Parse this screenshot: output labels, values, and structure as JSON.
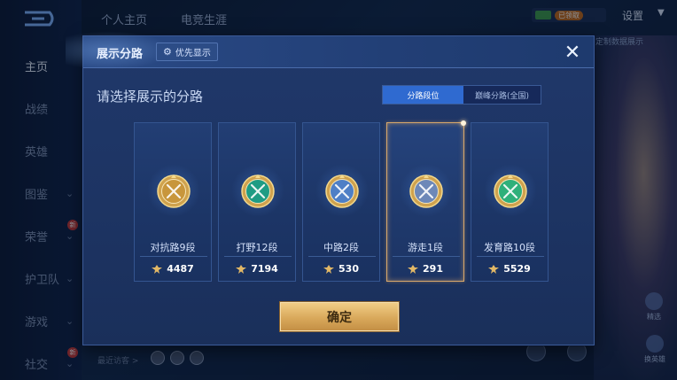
{
  "background": {
    "sidebar": {
      "items": [
        {
          "label": "主页",
          "active": true,
          "chevron": false,
          "new": false
        },
        {
          "label": "战绩",
          "active": false,
          "chevron": false,
          "new": false
        },
        {
          "label": "英雄",
          "active": false,
          "chevron": false,
          "new": false
        },
        {
          "label": "图鉴",
          "active": false,
          "chevron": true,
          "new": false
        },
        {
          "label": "荣誉",
          "active": false,
          "chevron": true,
          "new": true
        },
        {
          "label": "护卫队",
          "active": false,
          "chevron": true,
          "new": false
        },
        {
          "label": "游戏",
          "active": false,
          "chevron": true,
          "new": false
        },
        {
          "label": "社交",
          "active": false,
          "chevron": true,
          "new": true
        }
      ],
      "chevron": "⌄",
      "new_badge": "新"
    },
    "top_tabs": [
      "个人主页",
      "电竞生涯"
    ],
    "currency_badge": "已领取",
    "settings_label": "设置",
    "settings_caret": "▼",
    "hero_caption": "定制数据展示",
    "hero_btn1_label": "精选",
    "hero_btn2_label": "换英雄",
    "visitors_label": "最近访客 >"
  },
  "modal": {
    "title": "展示分路",
    "priority_label": "优先显示",
    "priority_icon": "gear-icon",
    "close_glyph": "✕",
    "select_prompt": "请选择展示的分路",
    "toggle": {
      "options": [
        "分路段位",
        "巅峰分路(全国)"
      ],
      "active_index": 0
    },
    "lanes": [
      {
        "rank": "对抗路9段",
        "score": "4487",
        "emblem": "clash-lane-emblem",
        "color": "#c8963c",
        "selected": false
      },
      {
        "rank": "打野12段",
        "score": "7194",
        "emblem": "jungle-emblem",
        "color": "#1f9c84",
        "selected": false
      },
      {
        "rank": "中路2段",
        "score": "530",
        "emblem": "mid-lane-emblem",
        "color": "#4e7fc6",
        "selected": false
      },
      {
        "rank": "游走1段",
        "score": "291",
        "emblem": "roam-emblem",
        "color": "#6d88b8",
        "selected": true
      },
      {
        "rank": "发育路10段",
        "score": "5529",
        "emblem": "farm-lane-emblem",
        "color": "#2fb07a",
        "selected": false
      }
    ],
    "confirm_label": "确定"
  },
  "colors": {
    "accent_blue": "#2f6ad0",
    "gold_button": "#d9a95b",
    "selected_border": "#d8a86b"
  }
}
